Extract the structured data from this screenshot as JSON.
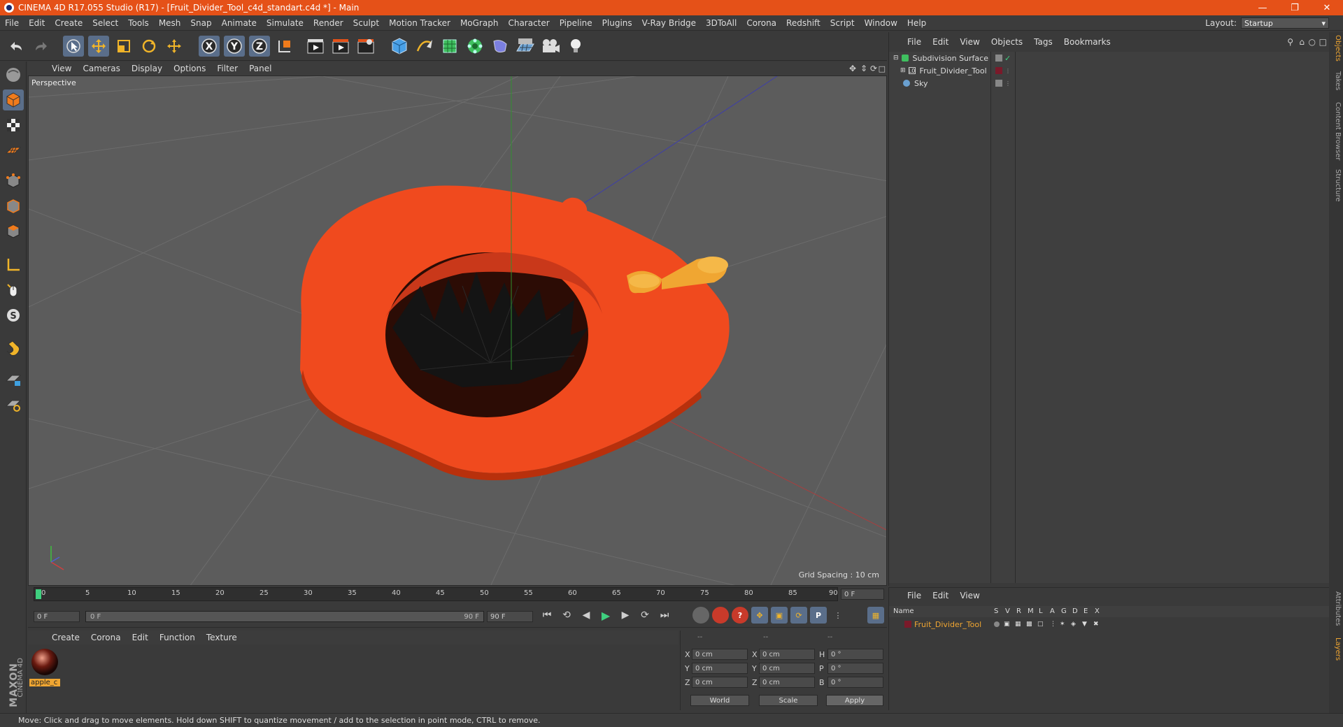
{
  "window": {
    "title": "CINEMA 4D R17.055 Studio (R17) - [Fruit_Divider_Tool_c4d_standart.c4d *] - Main"
  },
  "menu": [
    "File",
    "Edit",
    "Create",
    "Select",
    "Tools",
    "Mesh",
    "Snap",
    "Animate",
    "Simulate",
    "Render",
    "Sculpt",
    "Motion Tracker",
    "MoGraph",
    "Character",
    "Pipeline",
    "Plugins",
    "V-Ray Bridge",
    "3DToAll",
    "Corona",
    "Redshift",
    "Script",
    "Window",
    "Help"
  ],
  "layout": {
    "label": "Layout:",
    "value": "Startup"
  },
  "viewport": {
    "menu": [
      "View",
      "Cameras",
      "Display",
      "Options",
      "Filter",
      "Panel"
    ],
    "label": "Perspective",
    "grid_spacing": "Grid Spacing : 10 cm"
  },
  "timeline": {
    "ticks": [
      "0",
      "5",
      "10",
      "15",
      "20",
      "25",
      "30",
      "35",
      "40",
      "45",
      "50",
      "55",
      "60",
      "65",
      "70",
      "75",
      "80",
      "85",
      "90"
    ],
    "current_frame": "0 F",
    "start_field": "0 F",
    "range_start": "0 F",
    "range_end": "90 F",
    "end_field": "90 F"
  },
  "material": {
    "menu": [
      "Create",
      "Corona",
      "Edit",
      "Function",
      "Texture"
    ],
    "items": [
      {
        "name": "apple_c"
      }
    ]
  },
  "coords": {
    "header": [
      "--",
      "--",
      "--"
    ],
    "rows": [
      {
        "a": "X",
        "av": "0 cm",
        "b": "X",
        "bv": "0 cm",
        "c": "H",
        "cv": "0 °"
      },
      {
        "a": "Y",
        "av": "0 cm",
        "b": "Y",
        "bv": "0 cm",
        "c": "P",
        "cv": "0 °"
      },
      {
        "a": "Z",
        "av": "0 cm",
        "b": "Z",
        "bv": "0 cm",
        "c": "B",
        "cv": "0 °"
      }
    ],
    "mode": "World",
    "scale": "Scale",
    "apply": "Apply"
  },
  "objects": {
    "menu": [
      "File",
      "Edit",
      "View",
      "Objects",
      "Tags",
      "Bookmarks"
    ],
    "items": [
      {
        "name": "Subdivision Surface",
        "indent": 0
      },
      {
        "name": "Fruit_Divider_Tool",
        "indent": 1
      },
      {
        "name": "Sky",
        "indent": 0
      }
    ]
  },
  "layers": {
    "menu": [
      "File",
      "Edit",
      "View"
    ],
    "columns": [
      "Name",
      "S",
      "V",
      "R",
      "M",
      "L",
      "A",
      "G",
      "D",
      "E",
      "X"
    ],
    "items": [
      {
        "name": "Fruit_Divider_Tool"
      }
    ]
  },
  "side_tabs": [
    "Objects",
    "Takes",
    "Content Browser",
    "Structure",
    "Attributes",
    "Layers"
  ],
  "status": "Move: Click and drag to move elements. Hold down SHIFT to quantize movement / add to the selection in point mode, CTRL to remove.",
  "brand": {
    "maxon": "MAXON",
    "c4d": "CINEMA 4D"
  },
  "colors": {
    "title_bar": "#e55118",
    "apple": "#f04a1e",
    "handle": "#f0a632",
    "selection": "#5a6e8a"
  }
}
